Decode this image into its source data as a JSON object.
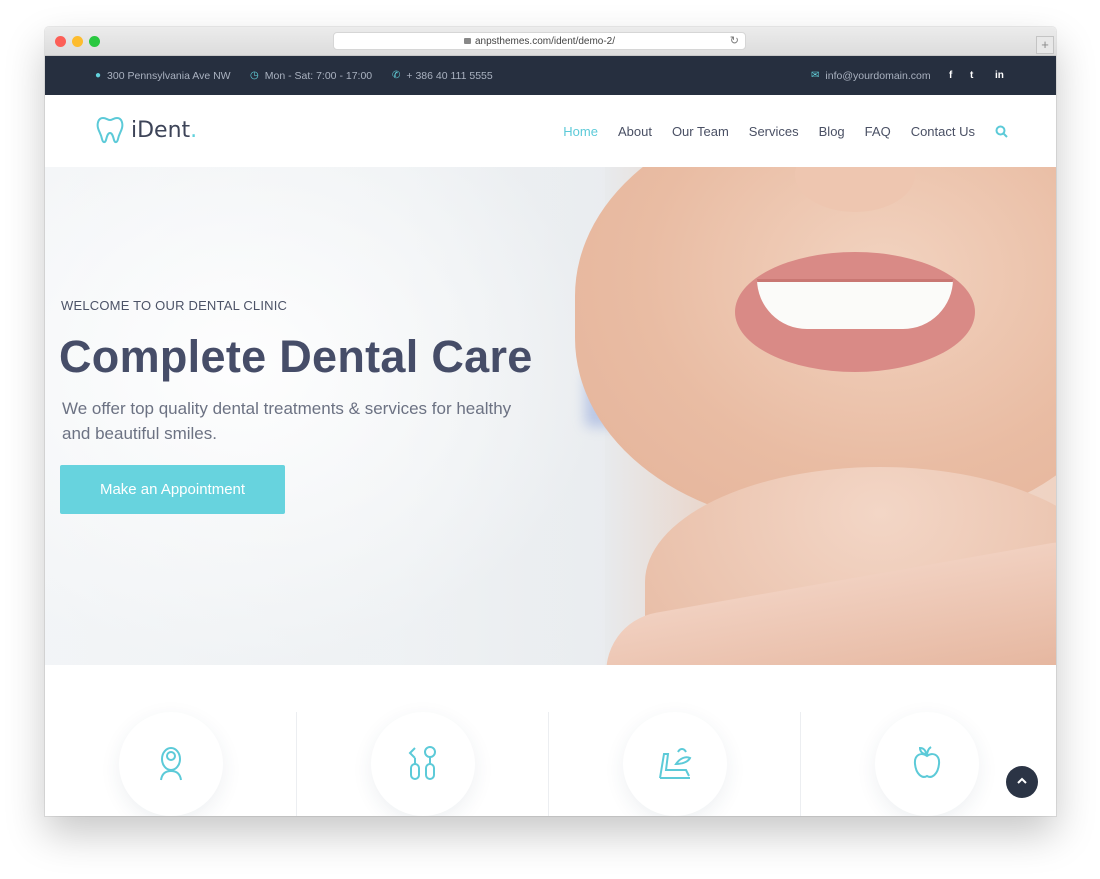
{
  "browser": {
    "url": "anpsthemes.com/ident/demo-2/",
    "new_tab": "+"
  },
  "topbar": {
    "address": "300 Pennsylvania Ave NW",
    "hours": "Mon - Sat: 7:00 - 17:00",
    "phone": "+ 386 40 111 5555",
    "email": "info@yourdomain.com",
    "social": [
      "f",
      "t",
      "in"
    ]
  },
  "header": {
    "logo": "iDent",
    "logo_dot": ".",
    "nav": [
      "Home",
      "About",
      "Our Team",
      "Services",
      "Blog",
      "FAQ",
      "Contact Us"
    ],
    "active_nav": "Home"
  },
  "hero": {
    "subtitle": "WELCOME TO OUR DENTAL CLINIC",
    "title": "Complete Dental Care",
    "text": "We offer top quality dental treatments & services for healthy and beautiful smiles.",
    "button": "Make an Appointment"
  },
  "features": {
    "icons": [
      "patient-icon",
      "dental-tools-icon",
      "dental-chair-icon",
      "apple-icon"
    ]
  },
  "colors": {
    "accent": "#5ccad8",
    "topbar_bg": "#262f3f",
    "heading": "#464d68"
  }
}
